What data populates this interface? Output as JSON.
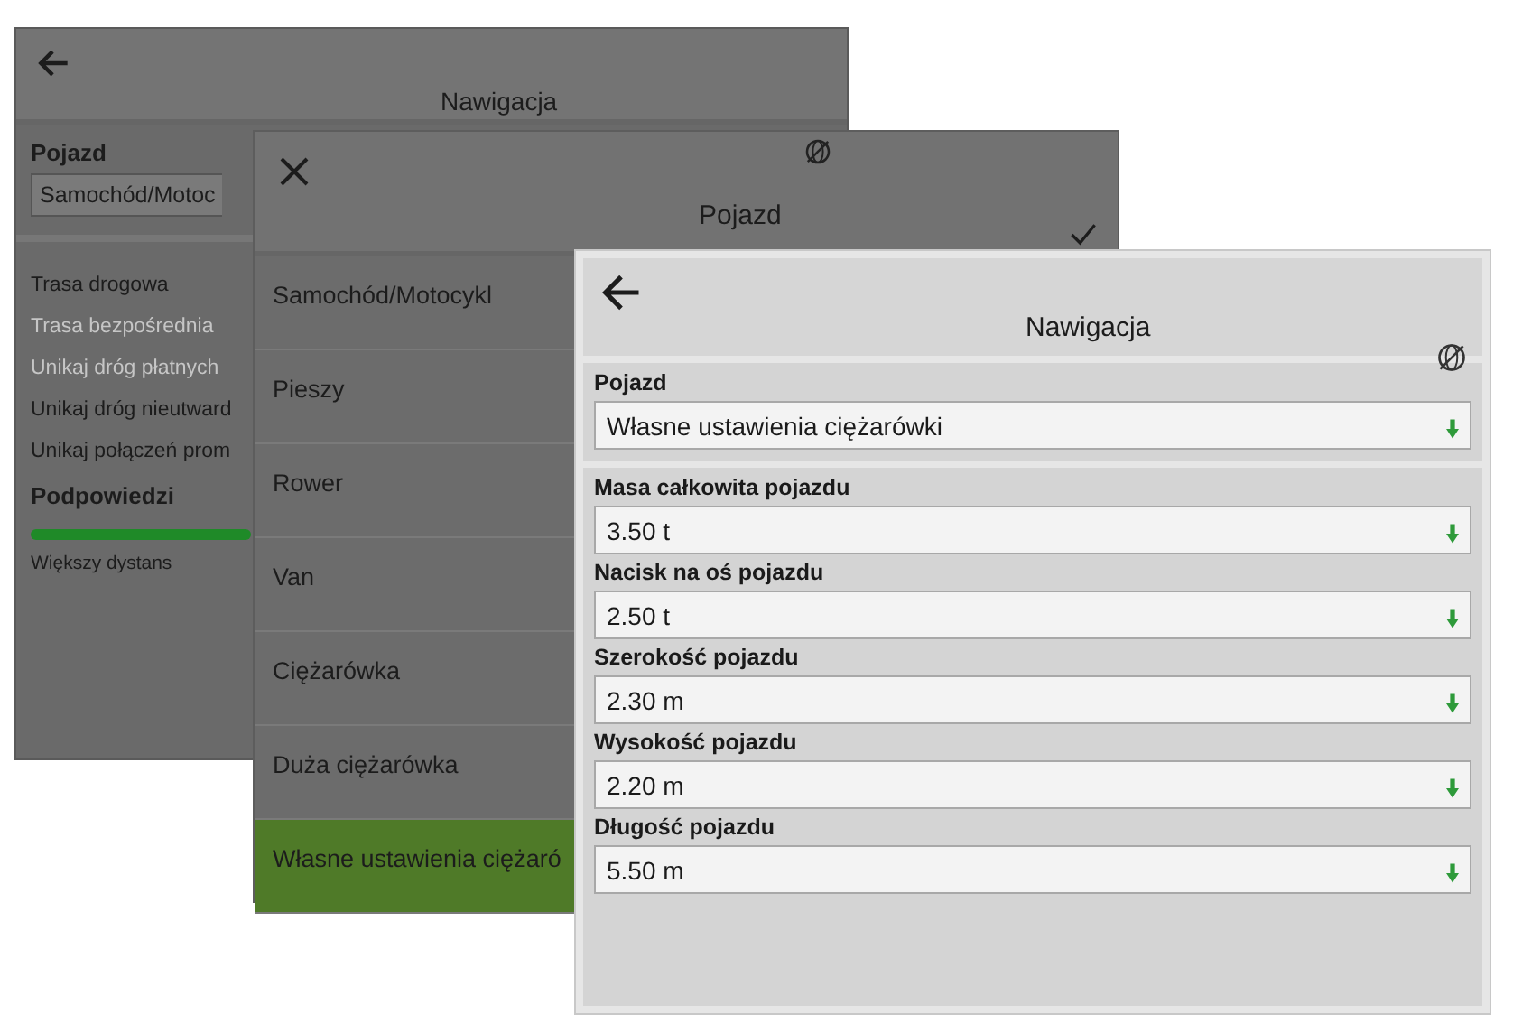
{
  "back_window": {
    "title": "Nawigacja",
    "vehicle_label": "Pojazd",
    "vehicle_value": "Samochód/Motoc",
    "options": [
      {
        "label": "Trasa drogowa",
        "disabled": false
      },
      {
        "label": "Trasa bezpośrednia",
        "disabled": true
      },
      {
        "label": "Unikaj dróg płatnych",
        "disabled": true
      },
      {
        "label": "Unikaj dróg nieutward",
        "disabled": false
      },
      {
        "label": "Unikaj połączeń prom",
        "disabled": false
      }
    ],
    "hints": {
      "label": "Podpowiedzi",
      "caption": "Większy dystans"
    }
  },
  "middle_window": {
    "title": "Pojazd",
    "items": [
      {
        "label": "Samochód/Motocykl",
        "selected": false
      },
      {
        "label": "Pieszy",
        "selected": false
      },
      {
        "label": "Rower",
        "selected": false
      },
      {
        "label": "Van",
        "selected": false
      },
      {
        "label": "Ciężarówka",
        "selected": false
      },
      {
        "label": "Duża ciężarówka",
        "selected": false
      },
      {
        "label": "Własne ustawienia ciężaró",
        "selected": true
      }
    ]
  },
  "front_window": {
    "title": "Nawigacja",
    "vehicle": {
      "label": "Pojazd",
      "value": "Własne ustawienia ciężarówki"
    },
    "fields": [
      {
        "label": "Masa całkowita pojazdu",
        "value": "3.50 t"
      },
      {
        "label": "Nacisk na oś pojazdu",
        "value": "2.50 t"
      },
      {
        "label": "Szerokość pojazdu",
        "value": "2.30 m"
      },
      {
        "label": "Wysokość pojazdu",
        "value": "2.20 m"
      },
      {
        "label": "Długość pojazdu",
        "value": "5.50 m"
      }
    ]
  }
}
